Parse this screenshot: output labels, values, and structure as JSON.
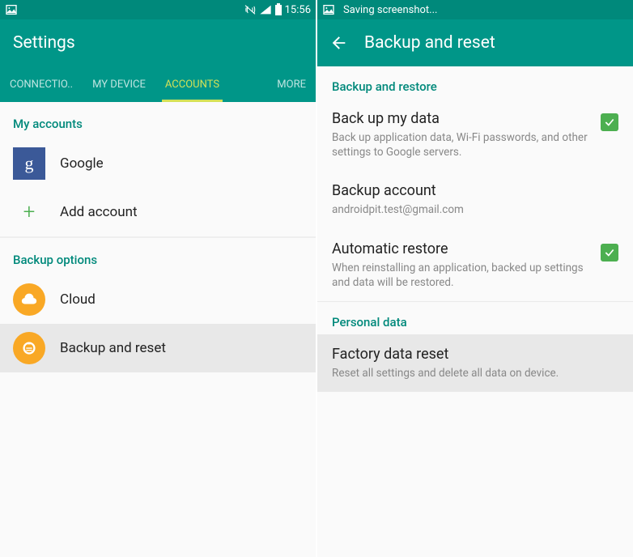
{
  "left": {
    "status": {
      "time": "15:56",
      "saving": ""
    },
    "appbar": {
      "title": "Settings"
    },
    "tabs": [
      "CONNECTIO..",
      "MY DEVICE",
      "ACCOUNTS",
      "MORE"
    ],
    "sections": {
      "accounts_header": "My accounts",
      "google": "Google",
      "add_account": "Add account",
      "backup_header": "Backup options",
      "cloud": "Cloud",
      "backup_reset": "Backup and reset"
    }
  },
  "right": {
    "status": {
      "saving": "Saving screenshot..."
    },
    "appbar": {
      "title": "Backup and reset"
    },
    "sections": {
      "restore_header": "Backup and restore",
      "backup_data": {
        "title": "Back up my data",
        "desc": "Back up application data, Wi-Fi passwords, and other settings to Google servers."
      },
      "backup_account": {
        "title": "Backup account",
        "desc": "androidpit.test@gmail.com"
      },
      "auto_restore": {
        "title": "Automatic restore",
        "desc": "When reinstalling an application, backed up settings and data will be restored."
      },
      "personal_header": "Personal data",
      "factory_reset": {
        "title": "Factory data reset",
        "desc": "Reset all settings and delete all data on device."
      }
    }
  }
}
